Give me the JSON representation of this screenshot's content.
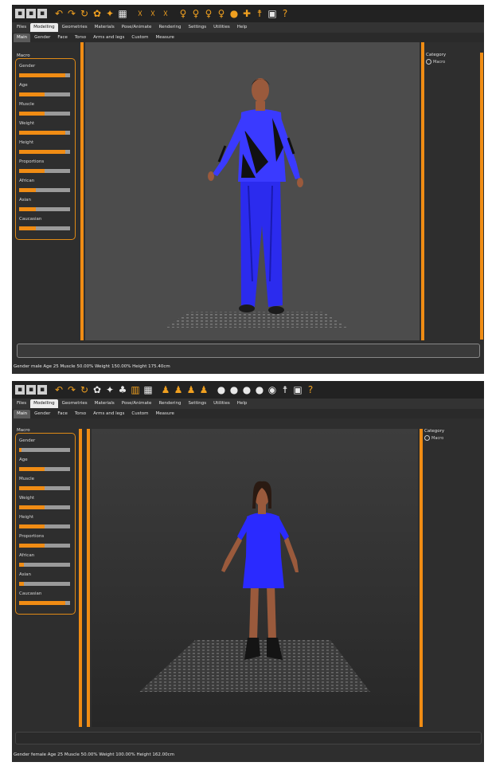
{
  "screen1": {
    "menu_tabs": [
      "Files",
      "Modelling",
      "Geometries",
      "Materials",
      "Pose/Animate",
      "Rendering",
      "Settings",
      "Utilities",
      "Help"
    ],
    "active_menu_tab": 1,
    "sub_tabs": [
      "Main",
      "Gender",
      "Face",
      "Torso",
      "Arms and legs",
      "Custom",
      "Measure"
    ],
    "active_sub_tab": 0,
    "group_title": "Macro",
    "sliders": [
      {
        "label": "Gender",
        "value": 0.9
      },
      {
        "label": "Age",
        "value": 0.5
      },
      {
        "label": "Muscle",
        "value": 0.5
      },
      {
        "label": "Weight",
        "value": 0.9
      },
      {
        "label": "Height",
        "value": 0.9
      },
      {
        "label": "Proportions",
        "value": 0.5
      },
      {
        "label": "African",
        "value": 0.33
      },
      {
        "label": "Asian",
        "value": 0.33
      },
      {
        "label": "Caucasian",
        "value": 0.33
      }
    ],
    "category_title": "Category",
    "category_item": "Macro",
    "status_text": "Gender male Age 25 Muscle 50.00% Weight 150.00% Height 175.40cm"
  },
  "screen2": {
    "menu_tabs": [
      "Files",
      "Modelling",
      "Geometries",
      "Materials",
      "Pose/Animate",
      "Rendering",
      "Settings",
      "Utilities",
      "Help"
    ],
    "active_menu_tab": 1,
    "sub_tabs": [
      "Main",
      "Gender",
      "Face",
      "Torso",
      "Arms and legs",
      "Custom",
      "Measure"
    ],
    "active_sub_tab": 0,
    "group_title": "Macro",
    "sliders": [
      {
        "label": "Gender",
        "value": 0.05
      },
      {
        "label": "Age",
        "value": 0.5
      },
      {
        "label": "Muscle",
        "value": 0.5
      },
      {
        "label": "Weight",
        "value": 0.5
      },
      {
        "label": "Height",
        "value": 0.5
      },
      {
        "label": "Proportions",
        "value": 0.5
      },
      {
        "label": "African",
        "value": 0.1
      },
      {
        "label": "Asian",
        "value": 0.1
      },
      {
        "label": "Caucasian",
        "value": 0.9
      }
    ],
    "category_title": "Category",
    "category_item": "Macro",
    "status_text": "Gender female Age 25 Muscle 50.00% Weight 100.00% Height 162.00cm"
  },
  "colors": {
    "accent": "#f08c14",
    "shirt_male": "#3a3aff",
    "pants_male": "#2b2bee",
    "dress_female": "#2a2aff",
    "skin": "#9a5a3c",
    "viewport": "#4c4c4c"
  },
  "toolbar_icons": [
    "new-icon",
    "save-icon",
    "export-icon",
    "undo-icon",
    "redo-icon",
    "reset-icon",
    "smooth-icon",
    "wireframe-icon",
    "background-icon",
    "skeleton-icon",
    "pose-icon",
    "camera-front-icon",
    "camera-back-icon",
    "camera-left-icon",
    "camera-right-icon",
    "camera-top-icon",
    "camera-bottom-icon",
    "grab-icon",
    "screenshot-icon",
    "help-icon"
  ]
}
